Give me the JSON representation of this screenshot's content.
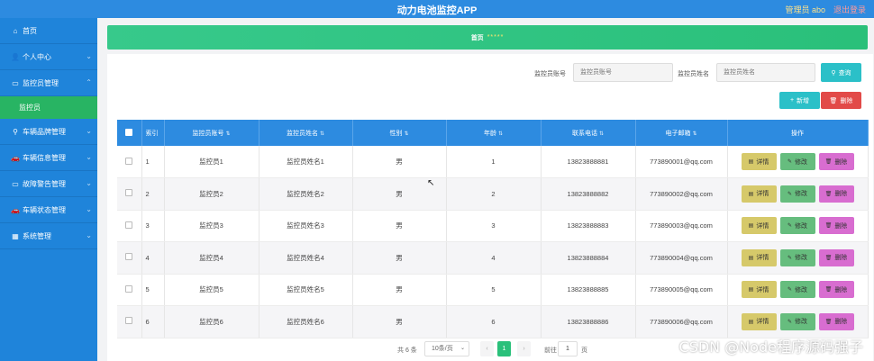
{
  "header": {
    "title": "动力电池监控APP",
    "admin_label": "管理员 abo",
    "logout_label": "退出登录"
  },
  "sidebar": {
    "items": [
      {
        "label": "首页",
        "icon": "home-icon"
      },
      {
        "label": "个人中心",
        "icon": "user-icon"
      },
      {
        "label": "监控员管理",
        "icon": "folder-icon"
      },
      {
        "label": "车辆品牌管理",
        "icon": "folder-icon"
      },
      {
        "label": "车辆信息管理",
        "icon": "car-icon"
      },
      {
        "label": "故障警告管理",
        "icon": "folder-icon"
      },
      {
        "label": "车辆状态管理",
        "icon": "car-icon"
      },
      {
        "label": "系统管理",
        "icon": "grid-icon"
      }
    ],
    "active_subitem": "监控员"
  },
  "breadcrumb": {
    "home": "首页",
    "separator": "*****"
  },
  "search": {
    "account_label": "监控员账号",
    "account_placeholder": "监控员账号",
    "name_label": "监控员姓名",
    "name_placeholder": "监控员姓名",
    "query_label": "查询"
  },
  "toolbar": {
    "add_label": "新增",
    "delete_label": "删除"
  },
  "table": {
    "headers": {
      "index": "索引",
      "account": "监控员账号",
      "name": "监控员姓名",
      "gender": "性别",
      "age": "年龄",
      "phone": "联系电话",
      "email": "电子邮箱",
      "actions": "操作"
    },
    "rows": [
      {
        "index": "1",
        "account": "监控员1",
        "name": "监控员姓名1",
        "gender": "男",
        "age": "1",
        "phone": "13823888881",
        "email": "773890001@qq.com"
      },
      {
        "index": "2",
        "account": "监控员2",
        "name": "监控员姓名2",
        "gender": "男",
        "age": "2",
        "phone": "13823888882",
        "email": "773890002@qq.com"
      },
      {
        "index": "3",
        "account": "监控员3",
        "name": "监控员姓名3",
        "gender": "男",
        "age": "3",
        "phone": "13823888883",
        "email": "773890003@qq.com"
      },
      {
        "index": "4",
        "account": "监控员4",
        "name": "监控员姓名4",
        "gender": "男",
        "age": "4",
        "phone": "13823888884",
        "email": "773890004@qq.com"
      },
      {
        "index": "5",
        "account": "监控员5",
        "name": "监控员姓名5",
        "gender": "男",
        "age": "5",
        "phone": "13823888885",
        "email": "773890005@qq.com"
      },
      {
        "index": "6",
        "account": "监控员6",
        "name": "监控员姓名6",
        "gender": "男",
        "age": "6",
        "phone": "13823888886",
        "email": "773890006@qq.com"
      }
    ],
    "actions": {
      "detail": "详情",
      "edit": "修改",
      "delete": "删除"
    }
  },
  "pagination": {
    "total": "共 6 条",
    "page_size": "10条/页",
    "current_page": "1",
    "goto_label": "前往",
    "goto_value": "1",
    "page_unit": "页"
  },
  "watermark": "CSDN @Node程序源码强子",
  "colors": {
    "header": "#2d8be0",
    "sidebar": "#1f84da",
    "active": "#28b463",
    "breadcrumb": "#37c98b",
    "query_button": "#2bc0c8",
    "danger": "#e24a48",
    "detail": "#d6c96a",
    "edit": "#66bd7e",
    "delete": "#d86dd0"
  }
}
